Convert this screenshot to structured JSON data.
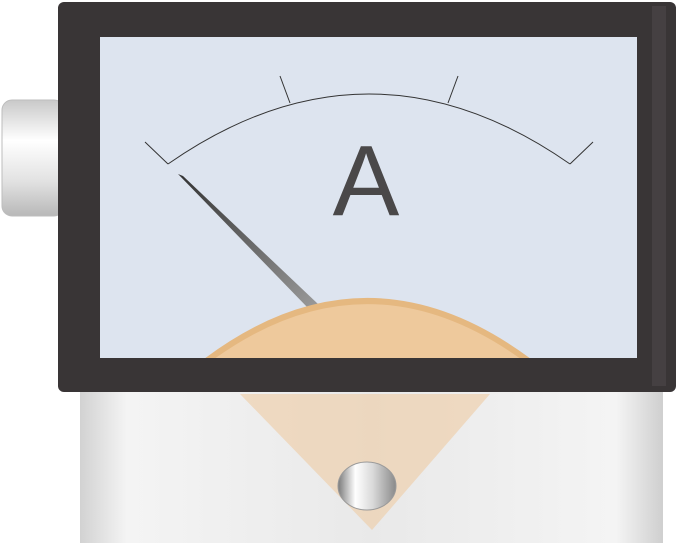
{
  "meter": {
    "unit_label": "A",
    "needle_position": 0,
    "major_ticks": 4,
    "colors": {
      "housing": "#393536",
      "dial_face": "#dde4ef",
      "scale_line": "#333333",
      "needle": "#555555",
      "pivot_cover": "#eec99c",
      "pivot_cover_edge": "#e5b880",
      "base_metal": "#e6e6e6"
    }
  }
}
